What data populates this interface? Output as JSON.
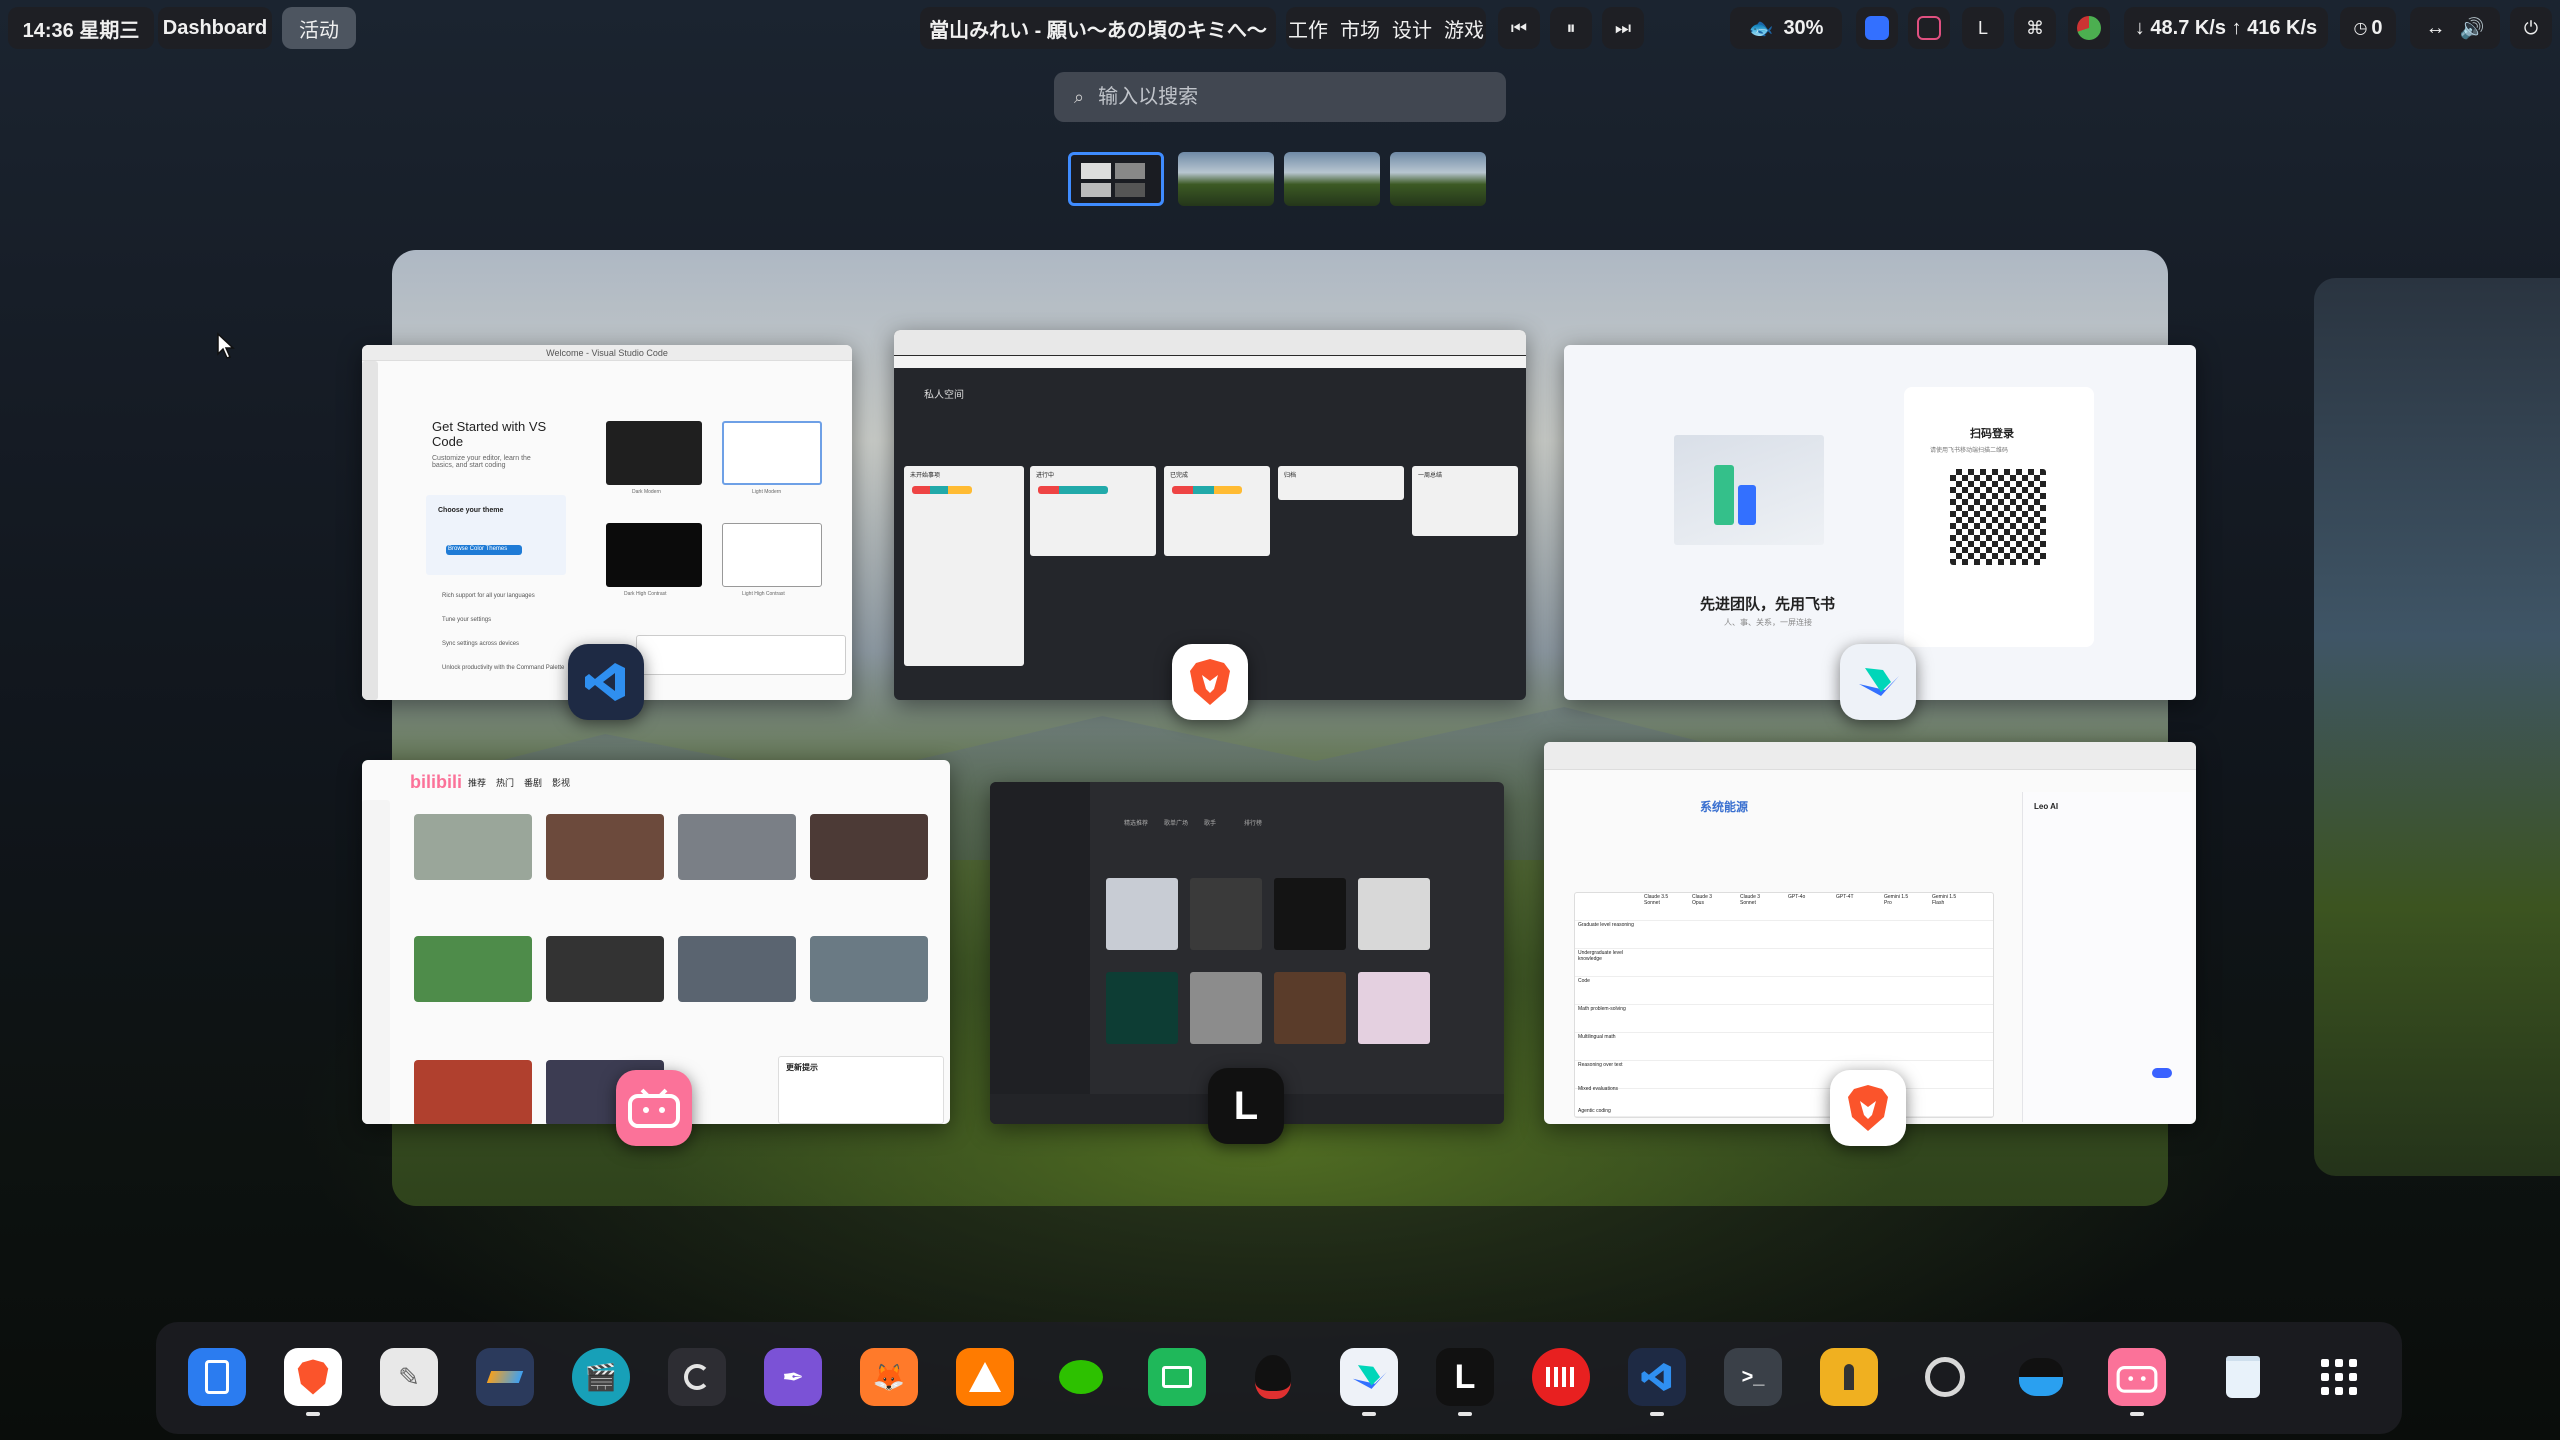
{
  "topbar": {
    "clock": "14:36 星期三",
    "dashboard": "Dashboard",
    "activities": "活动",
    "media_title": "當山みれい - 願い～あの頃のキミへ～",
    "workspaces": [
      "工作",
      "市场",
      "设计",
      "游戏"
    ],
    "battery_icon": "fish-icon",
    "battery": "30%",
    "net_down": "↓ 48.7 K/s",
    "net_up": "↑ 416 K/s",
    "notif_count": "0"
  },
  "search": {
    "placeholder": "输入以搜索"
  },
  "windows": {
    "vscode": {
      "title": "Welcome - Visual Studio Code",
      "heading": "Get Started with VS Code",
      "sub": "Customize your editor, learn the basics, and start coding",
      "theme_item": "Choose your theme",
      "browse_btn": "Browse Color Themes",
      "items": [
        "Rich support for all your languages",
        "Tune your settings",
        "Sync settings across devices",
        "Unlock productivity with the Command Palette"
      ],
      "theme_labels": [
        "Dark Modern",
        "Light Modern",
        "Dark High Contrast",
        "Light High Contrast"
      ]
    },
    "kanban": {
      "title": "私人空间",
      "columns": [
        "未开始事项",
        "进行中",
        "已完成",
        "归档",
        "一周总结"
      ]
    },
    "feishu": {
      "qr_title": "扫码登录",
      "qr_sub": "请使用飞书移动端扫描二维码",
      "slogan": "先进团队，先用飞书",
      "slogan_sub": "人、事、关系，一屏连接"
    },
    "bilibili": {
      "logo": "bilibili",
      "tabs": [
        "推荐",
        "热门",
        "番剧",
        "影视"
      ],
      "popup_title": "更新提示"
    },
    "music": {
      "nav": [
        "精选推荐",
        "歌单广场",
        "歌手",
        "排行榜"
      ]
    },
    "brave_table": {
      "heading": "系统能源",
      "cols": [
        "Claude 3.5 Sonnet",
        "Claude 3 Opus",
        "Claude 3 Sonnet",
        "GPT-4o",
        "GPT-4T",
        "Gemini 1.5 Pro",
        "Gemini 1.5 Flash"
      ],
      "rows": [
        "Graduate level reasoning",
        "Undergraduate level knowledge",
        "Code",
        "Math problem-solving",
        "Multilingual math",
        "Reasoning over text",
        "Mixed evaluations",
        "Agentic coding"
      ],
      "assistant": "Leo AI"
    }
  },
  "dock": [
    "finder-icon",
    "brave-icon",
    "text-editor-icon",
    "layers-icon",
    "video-editor-icon",
    "blender-icon",
    "paint-icon",
    "gimp-icon",
    "vlc-icon",
    "wechat-icon",
    "file-manager-icon",
    "qq-icon",
    "feishu-icon",
    "l-app-icon",
    "netease-music-icon",
    "vscode-icon",
    "terminal-icon",
    "joystick-icon",
    "steam-icon",
    "qq-penguin-icon",
    "bilibili-icon",
    "recycle-bin-icon",
    "app-grid-icon"
  ],
  "colors": {
    "accent": "#3f8cff",
    "bilibili": "#fb7299",
    "brave": "#fb542b",
    "vscode": "#1f7bd6",
    "feishu": "#3370ff"
  }
}
